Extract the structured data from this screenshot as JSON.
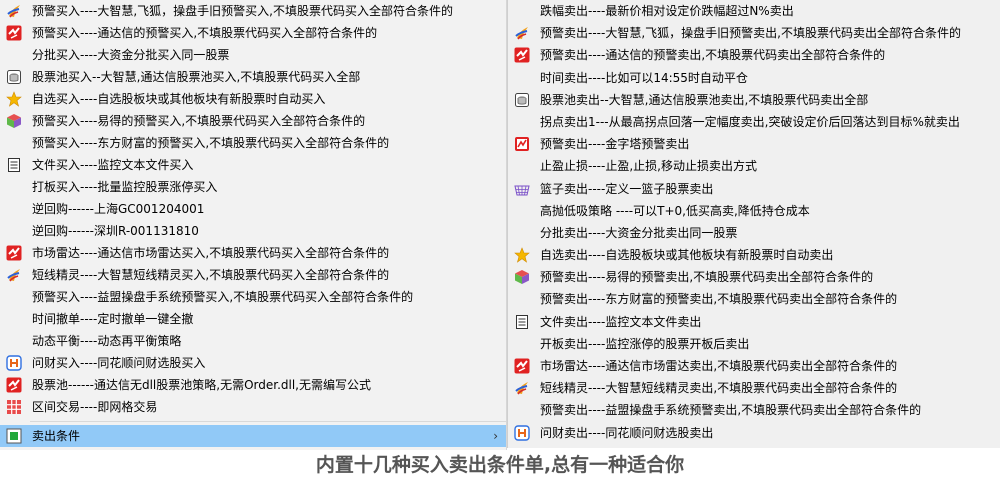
{
  "left_menu": {
    "items": [
      {
        "label": "预警买入----大智慧,飞狐，操盘手旧预警买入,不填股票代码买入全部符合条件的",
        "icon": "flame-icon"
      },
      {
        "label": "预警买入----通达信的预警买入,不填股票代码买入全部符合条件的",
        "icon": "tdx-red-icon"
      },
      {
        "label": "分批买入----大资金分批买入同一股票",
        "icon": ""
      },
      {
        "label": "股票池买入--大智慧,通达信股票池买入,不填股票代码买入全部",
        "icon": "database-icon"
      },
      {
        "label": "自选买入----自选股板块或其他板块有新股票时自动买入",
        "icon": "star-icon"
      },
      {
        "label": "预警买入----易得的预警买入,不填股票代码买入全部符合条件的",
        "icon": "cube-icon"
      },
      {
        "label": "预警买入----东方财富的预警买入,不填股票代码买入全部符合条件的",
        "icon": ""
      },
      {
        "label": "文件买入----监控文本文件买入",
        "icon": "document-icon"
      },
      {
        "label": "打板买入----批量监控股票涨停买入",
        "icon": ""
      },
      {
        "label": "逆回购------上海GC001204001",
        "icon": ""
      },
      {
        "label": "逆回购------深圳R-001131810",
        "icon": ""
      },
      {
        "label": "市场雷达----通达信市场雷达买入,不填股票代码买入全部符合条件的",
        "icon": "tdx-red-icon"
      },
      {
        "label": "短线精灵----大智慧短线精灵买入,不填股票代码买入全部符合条件的",
        "icon": "flame-icon"
      },
      {
        "label": "预警买入----益盟操盘手系统预警买入,不填股票代码买入全部符合条件的",
        "icon": ""
      },
      {
        "label": "时间撤单----定时撤单一键全撤",
        "icon": ""
      },
      {
        "label": "动态平衡----动态再平衡策略",
        "icon": ""
      },
      {
        "label": "问财买入----同花顺问财选股买入",
        "icon": "ths-icon"
      },
      {
        "label": "股票池------通达信无dll股票池策略,无需Order.dll,无需编写公式",
        "icon": "tdx-red-icon"
      },
      {
        "label": "区间交易----即网格交易",
        "icon": "grid-icon"
      }
    ],
    "submenu_label": "卖出条件",
    "submenu_arrow": "›"
  },
  "right_menu": {
    "items": [
      {
        "label": "跌幅卖出----最新价相对设定价跌幅超过N%卖出",
        "icon": ""
      },
      {
        "label": "预警卖出----大智慧,飞狐，操盘手旧预警卖出,不填股票代码卖出全部符合条件的",
        "icon": "flame-icon"
      },
      {
        "label": "预警卖出----通达信的预警卖出,不填股票代码卖出全部符合条件的",
        "icon": "tdx-red-icon"
      },
      {
        "label": "时间卖出----比如可以14:55时自动平仓",
        "icon": ""
      },
      {
        "label": "股票池卖出--大智慧,通达信股票池卖出,不填股票代码卖出全部",
        "icon": "database-icon"
      },
      {
        "label": "拐点卖出1---从最高拐点回落一定幅度卖出,突破设定价后回落达到目标%就卖出",
        "icon": ""
      },
      {
        "label": "预警卖出----金字塔预警卖出",
        "icon": "pyramid-icon"
      },
      {
        "label": "止盈止损----止盈,止损,移动止损卖出方式",
        "icon": ""
      },
      {
        "label": "篮子卖出----定义一篮子股票卖出",
        "icon": "basket-icon"
      },
      {
        "label": "高抛低吸策略 ----可以T+0,低买高卖,降低持仓成本",
        "icon": ""
      },
      {
        "label": "分批卖出----大资金分批卖出同一股票",
        "icon": ""
      },
      {
        "label": "自选卖出----自选股板块或其他板块有新股票时自动卖出",
        "icon": "star-icon"
      },
      {
        "label": "预警卖出----易得的预警卖出,不填股票代码卖出全部符合条件的",
        "icon": "cube-icon"
      },
      {
        "label": "预警卖出----东方财富的预警卖出,不填股票代码卖出全部符合条件的",
        "icon": ""
      },
      {
        "label": "文件卖出----监控文本文件卖出",
        "icon": "document-icon"
      },
      {
        "label": "开板卖出----监控涨停的股票开板后卖出",
        "icon": ""
      },
      {
        "label": "市场雷达----通达信市场雷达卖出,不填股票代码卖出全部符合条件的",
        "icon": "tdx-red-icon"
      },
      {
        "label": "短线精灵----大智慧短线精灵卖出,不填股票代码卖出全部符合条件的",
        "icon": "flame-icon"
      },
      {
        "label": "预警卖出----益盟操盘手系统预警卖出,不填股票代码卖出全部符合条件的",
        "icon": ""
      },
      {
        "label": "问财卖出----同花顺问财选股卖出",
        "icon": "ths-icon"
      }
    ]
  },
  "footer": {
    "caption": "内置十几种买入卖出条件单,总有一种适合你"
  },
  "colors": {
    "highlight": "#91c9f7",
    "menu_bg": "#f2f2f2",
    "footer_text": "#555555"
  }
}
